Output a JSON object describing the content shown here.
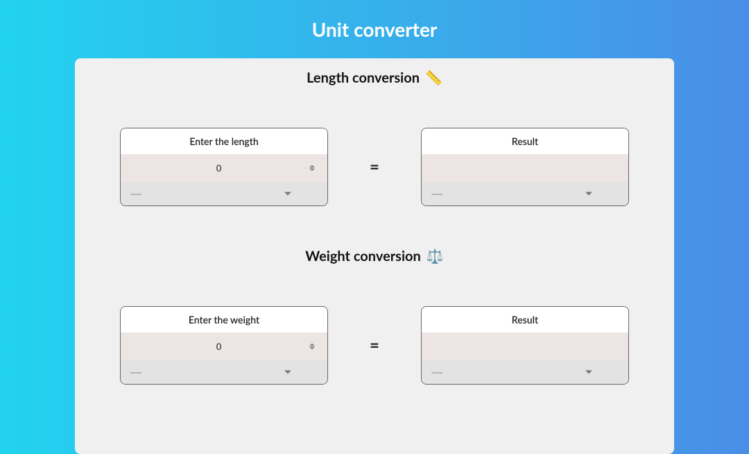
{
  "page_title": "Unit converter",
  "sections": {
    "length": {
      "header": "Length conversion",
      "icon": "ruler-icon",
      "icon_glyph": "📏",
      "input_label": "Enter the length",
      "input_value": "0",
      "input_unit_selected": "----",
      "result_label": "Result",
      "result_value": "",
      "result_unit_selected": "----",
      "equals": "="
    },
    "weight": {
      "header": "Weight conversion",
      "icon": "scale-icon",
      "icon_glyph": "⚖️",
      "input_label": "Enter the weight",
      "input_value": "0",
      "input_unit_selected": "----",
      "result_label": "Result",
      "result_value": "",
      "result_unit_selected": "----",
      "equals": "="
    }
  }
}
